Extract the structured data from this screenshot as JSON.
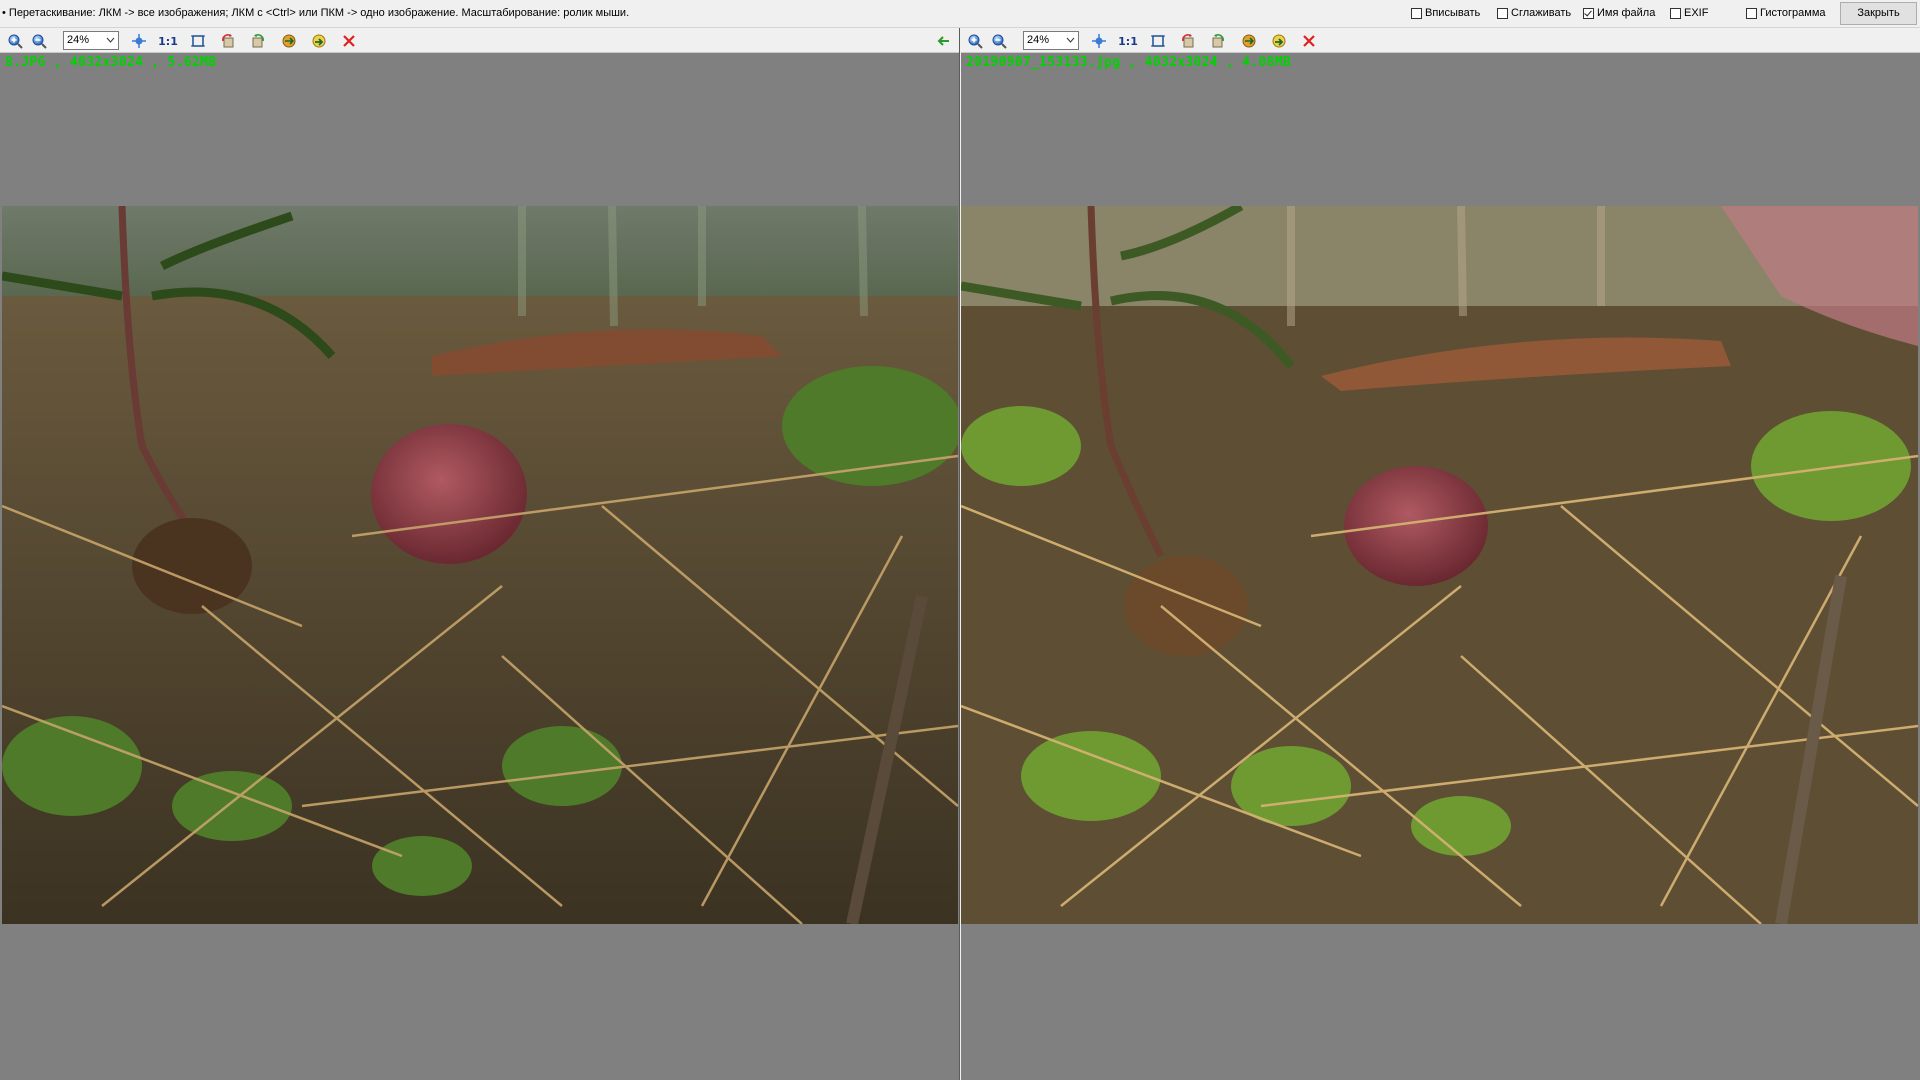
{
  "topbar": {
    "hint": "• Перетаскивание: ЛКМ -> все изображения; ЛКМ с <Ctrl> или ПКМ -> одно изображение. Масштабирование: ролик мыши.",
    "options": [
      {
        "label": "Вписывать",
        "checked": false
      },
      {
        "label": "Сглаживать",
        "checked": false
      },
      {
        "label": "Имя файла",
        "checked": true
      },
      {
        "label": "EXIF",
        "checked": false
      },
      {
        "label": "Гистограмма",
        "checked": false
      }
    ],
    "close_label": "Закрыть"
  },
  "left": {
    "zoom": "24%",
    "one_to_one": "1:1",
    "file": {
      "name": "8.JPG",
      "dimensions": "4032x3024",
      "size": "5.62MB",
      "display": "8.JPG , 4032x3024 , 5.62MB"
    },
    "toolbar_icons": [
      "zoom-in-icon",
      "zoom-out-icon",
      "fit-icon",
      "actual-size-icon",
      "crop-frame-icon",
      "rotate-left-icon",
      "rotate-right-icon",
      "flip-icon",
      "save-icon",
      "close-icon",
      "back-arrow-icon"
    ]
  },
  "right": {
    "zoom": "24%",
    "one_to_one": "1:1",
    "file": {
      "name": "20190907_153133.jpg",
      "dimensions": "4032x3024",
      "size": "4.08MB",
      "display": "20190907_153133.jpg , 4032x3024 , 4.08MB"
    },
    "toolbar_icons": [
      "zoom-in-icon",
      "zoom-out-icon",
      "fit-icon",
      "actual-size-icon",
      "crop-frame-icon",
      "rotate-left-icon",
      "rotate-right-icon",
      "flip-icon",
      "save-icon",
      "close-icon"
    ]
  },
  "colors": {
    "filename_text": "#00d200",
    "pane_background": "#808080",
    "close_icon": "#e02020"
  }
}
